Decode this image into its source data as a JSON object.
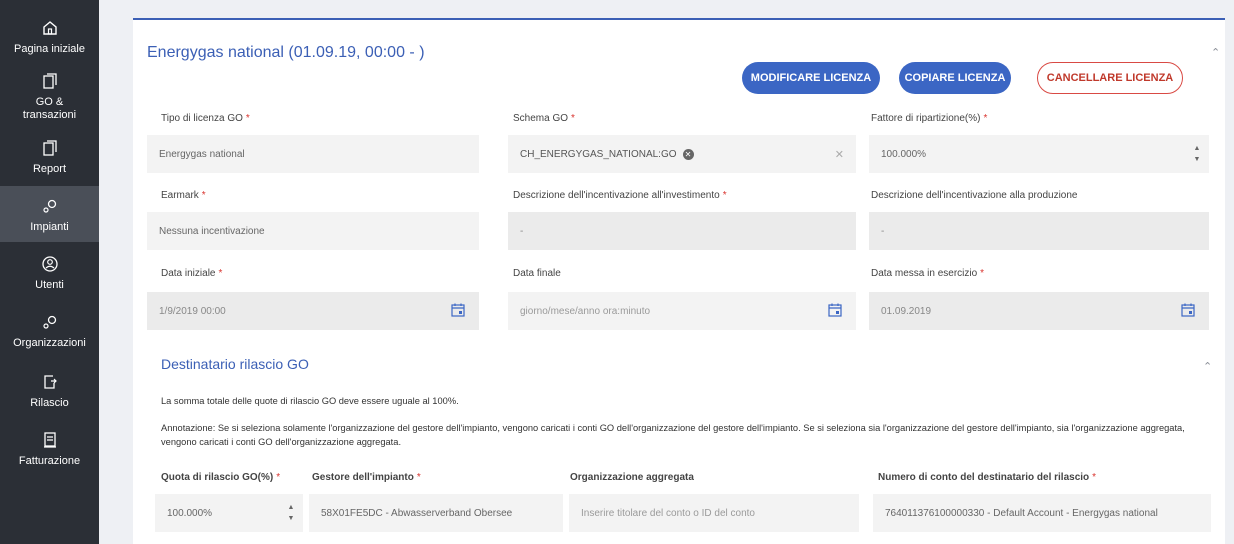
{
  "sidebar": {
    "items": [
      {
        "label": "Pagina iniziale",
        "icon": "home-icon"
      },
      {
        "label": "GO &\ntransazioni",
        "icon": "document-icon"
      },
      {
        "label": "Report",
        "icon": "document-icon"
      },
      {
        "label": "Impianti",
        "icon": "plant-icon"
      },
      {
        "label": "Utenti",
        "icon": "user-icon"
      },
      {
        "label": "Organizzazioni",
        "icon": "organization-icon"
      },
      {
        "label": "Rilascio",
        "icon": "release-icon"
      },
      {
        "label": "Fatturazione",
        "icon": "invoice-icon"
      }
    ],
    "active": "Impianti"
  },
  "header": {
    "title": "Energygas national (01.09.19, 00:00 - )",
    "buttons": {
      "modify": "MODIFICARE LICENZA",
      "copy": "COPIARE LICENZA",
      "delete": "CANCELLARE LICENZA"
    }
  },
  "form": {
    "tipo_label": "Tipo di licenza GO",
    "tipo_value": "Energygas national",
    "schema_label": "Schema GO",
    "schema_value": "CH_ENERGYGAS_NATIONAL:GO",
    "fattore_label": "Fattore di ripartizione(%)",
    "fattore_value": "100.000%",
    "earmark_label": "Earmark",
    "earmark_value": "Nessuna incentivazione",
    "desc_inv_label": "Descrizione dell'incentivazione all'investimento",
    "desc_inv_value": "-",
    "desc_prod_label": "Descrizione dell'incentivazione alla produzione",
    "desc_prod_value": "-",
    "data_iniziale_label": "Data iniziale",
    "data_iniziale_value": "1/9/2019 00:00",
    "data_finale_label": "Data finale",
    "data_finale_placeholder": "giorno/mese/anno ora:minuto",
    "data_messa_label": "Data messa in esercizio",
    "data_messa_value": "01.09.2019",
    "required_mark": "*"
  },
  "destinatario": {
    "title": "Destinatario rilascio GO",
    "note1": "La somma totale delle quote di rilascio GO deve essere uguale al 100%.",
    "note2": "Annotazione: Se si seleziona solamente l'organizzazione del gestore dell'impianto, vengono caricati i conti GO dell'organizzazione del gestore dell'impianto. Se si seleziona sia l'organizzazione del gestore dell'impianto, sia l'organizzazione aggregata, vengono caricati i conti GO dell'organizzazione aggregata.",
    "col_quota": "Quota di rilascio GO(%)",
    "col_gestore": "Gestore dell'impianto",
    "col_org": "Organizzazione aggregata",
    "col_numero": "Numero di conto del destinatario del rilascio",
    "quota_value": "100.000%",
    "gestore_value": "58X01FE5DC - Abwasserverband Obersee",
    "org_placeholder": "Inserire titolare del conto o ID del conto",
    "numero_value": "764011376100000330 - Default Account - Energygas national"
  },
  "colors": {
    "accent": "#3b5fb5",
    "button_primary": "#3b66c4",
    "danger": "#d94a44",
    "sidebar_bg": "#2b2f36"
  }
}
